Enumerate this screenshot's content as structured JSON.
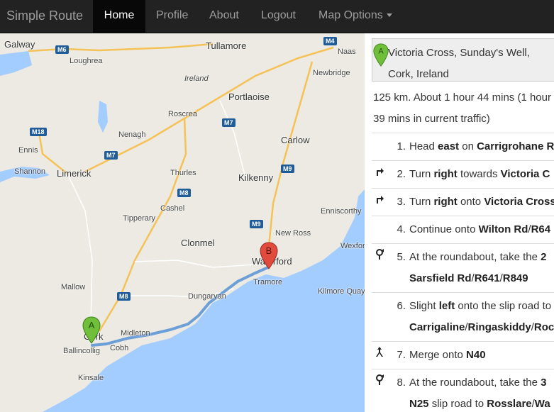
{
  "navbar": {
    "brand": "Simple Route",
    "items": [
      {
        "label": "Home",
        "active": true
      },
      {
        "label": "Profile"
      },
      {
        "label": "About"
      },
      {
        "label": "Logout"
      },
      {
        "label": "Map Options"
      }
    ]
  },
  "map": {
    "labels": {
      "galway": "Galway",
      "loughrea": "Loughrea",
      "tullamore": "Tullamore",
      "athy_ireland": "Ireland",
      "portlaoise": "Portlaoise",
      "newbridge": "Newbridge",
      "naas": "Naas",
      "roscrea": "Roscrea",
      "nenagh": "Nenagh",
      "ennis": "Ennis",
      "shannon": "Shannon",
      "limerick": "Limerick",
      "thurles": "Thurles",
      "carlow": "Carlow",
      "kilkenny": "Kilkenny",
      "cashel": "Cashel",
      "tipperary": "Tipperary",
      "enniscorthy": "Enniscorthy",
      "new_ross": "New Ross",
      "clonmel": "Clonmel",
      "waterford": "Waterford",
      "wexford": "Wexford",
      "mallow": "Mallow",
      "tramore": "Tramore",
      "kilmore_quay": "Kilmore Quay",
      "dungarvan": "Dungarvan",
      "cork": "Cork",
      "midleton": "Midleton",
      "ballincollig": "Ballincollig",
      "cobh": "Cobh",
      "kinsale": "Kinsale"
    },
    "shields": {
      "m6": "M6",
      "m4": "M4",
      "m18": "M18",
      "m7a": "M7",
      "m7b": "M7",
      "m8a": "M8",
      "m8b": "M8",
      "m9a": "M9",
      "m9b": "M9"
    },
    "marker_a": "A",
    "marker_b": "B",
    "colors": {
      "route": "#6c9fd8",
      "sea": "#a3ccff",
      "land": "#eceae2",
      "motorway": "#f5c257",
      "marker_a": "#6fbf3a",
      "marker_b": "#e04b3e"
    }
  },
  "directions": {
    "origin": "Victoria Cross, Sunday's Well, Cork, Ireland",
    "origin_marker": "A",
    "summary": "125 km. About 1 hour 44 mins (1 hour 39 mins in current traffic)",
    "steps": [
      {
        "num": "1.",
        "icon": "none",
        "line1": [
          "Head ",
          "east",
          " on ",
          "Carrigrohane R"
        ],
        "line2": []
      },
      {
        "num": "2.",
        "icon": "turn-right-icon",
        "line1": [
          "Turn ",
          "right",
          " towards ",
          "Victoria C"
        ],
        "line2": []
      },
      {
        "num": "3.",
        "icon": "turn-right-icon",
        "line1": [
          "Turn ",
          "right",
          " onto ",
          "Victoria Cross"
        ],
        "line2": []
      },
      {
        "num": "4.",
        "icon": "none",
        "line1": [
          "Continue onto ",
          "Wilton Rd",
          "/",
          "R64"
        ],
        "line2": []
      },
      {
        "num": "5.",
        "icon": "roundabout-icon",
        "line1": [
          "At the roundabout, take the ",
          "2"
        ],
        "line2": [
          "Sarsfield Rd",
          "/",
          "R641",
          "/",
          "R849"
        ]
      },
      {
        "num": "6.",
        "icon": "none",
        "line1": [
          "Slight ",
          "left",
          " onto the slip road to"
        ],
        "line2": [
          "Carrigaline",
          "/",
          "Ringaskiddy",
          "/",
          "Roc"
        ]
      },
      {
        "num": "7.",
        "icon": "merge-icon",
        "line1": [
          "Merge onto ",
          "N40"
        ],
        "line2": []
      },
      {
        "num": "8.",
        "icon": "roundabout-icon",
        "line1": [
          "At the roundabout, take the ",
          "3"
        ],
        "line2": [
          "N25",
          " slip road to ",
          "Rosslare",
          "/",
          "Wa"
        ]
      }
    ]
  }
}
